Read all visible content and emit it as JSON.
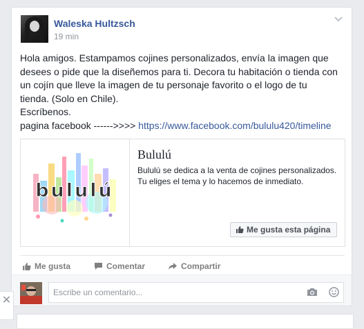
{
  "post": {
    "author": "Waleska Hultzsch",
    "time": "19 min",
    "text_lines": [
      "Hola amigos. Estampamos cojines personalizados, envía la imagen que",
      "desees o pide que la diseñemos para ti. Decora tu habitación o tienda con",
      "un cojín que lleve la imagen de tu personaje favorito o el logo de tu",
      "tienda. (Solo en Chile).",
      "Escríbenos."
    ],
    "link_prefix": "pagina facebook ------>>>> ",
    "link_url": "https://www.facebook.com/bululu420/timeline"
  },
  "attachment": {
    "logo_text": "bululú",
    "title": "Bululú",
    "description": "Bululú se dedica a la venta de cojines personalizados. Tu eliges el tema y lo hacemos de inmediato.",
    "like_page_label": "Me gusta esta página"
  },
  "actions": {
    "like": "Me gusta",
    "comment": "Comentar",
    "share": "Compartir"
  },
  "comment_box": {
    "placeholder": "Escribe un comentario..."
  },
  "icons": {
    "chevron": "chevron-down-icon",
    "thumbs": "thumbs-up-icon",
    "comment": "comment-bubble-icon",
    "share": "share-arrow-icon",
    "camera": "camera-icon",
    "emoji": "emoji-icon",
    "close": "close-icon"
  },
  "colors": {
    "link": "#365899",
    "text": "#1d2129",
    "muted": "#90949c"
  }
}
